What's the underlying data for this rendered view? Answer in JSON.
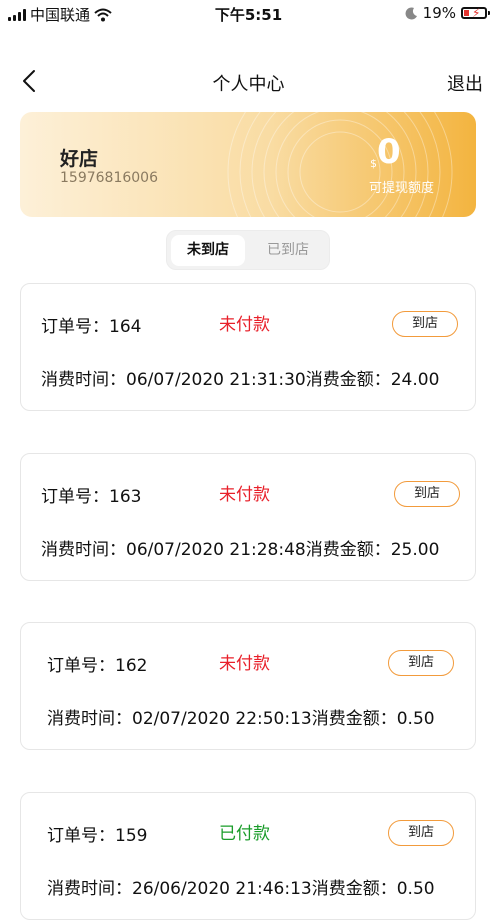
{
  "status_bar": {
    "carrier": "中国联通",
    "time": "下午5:51",
    "battery": "19%"
  },
  "nav": {
    "title": "个人中心",
    "logout": "退出"
  },
  "account_card": {
    "shop_name": "好店",
    "phone": "15976816006",
    "currency": "$",
    "amount": "0",
    "amount_label": "可提现额度"
  },
  "tabs": [
    {
      "label": "未到店",
      "active": true
    },
    {
      "label": "已到店",
      "active": false
    }
  ],
  "orders": [
    {
      "id_text": "订单号：164",
      "status": "未付款",
      "paid": false,
      "button": "到店",
      "detail": "消费时间：06/07/2020 21:31:30消费金额：24.00"
    },
    {
      "id_text": "订单号：163",
      "status": "未付款",
      "paid": false,
      "button": "到店",
      "detail": "消费时间：06/07/2020 21:28:48消费金额：25.00"
    },
    {
      "id_text": "订单号：162",
      "status": "未付款",
      "paid": false,
      "button": "到店",
      "detail": "消费时间：02/07/2020 22:50:13消费金额：0.50"
    },
    {
      "id_text": "订单号：159",
      "status": "已付款",
      "paid": true,
      "button": "到店",
      "detail": "消费时间：26/06/2020 21:46:13消费金额：0.50"
    }
  ],
  "colors": {
    "unpaid": "#e8202a",
    "paid": "#1a9c2a",
    "button_border": "#f29b3c",
    "card_accent": "#f3b43f"
  }
}
